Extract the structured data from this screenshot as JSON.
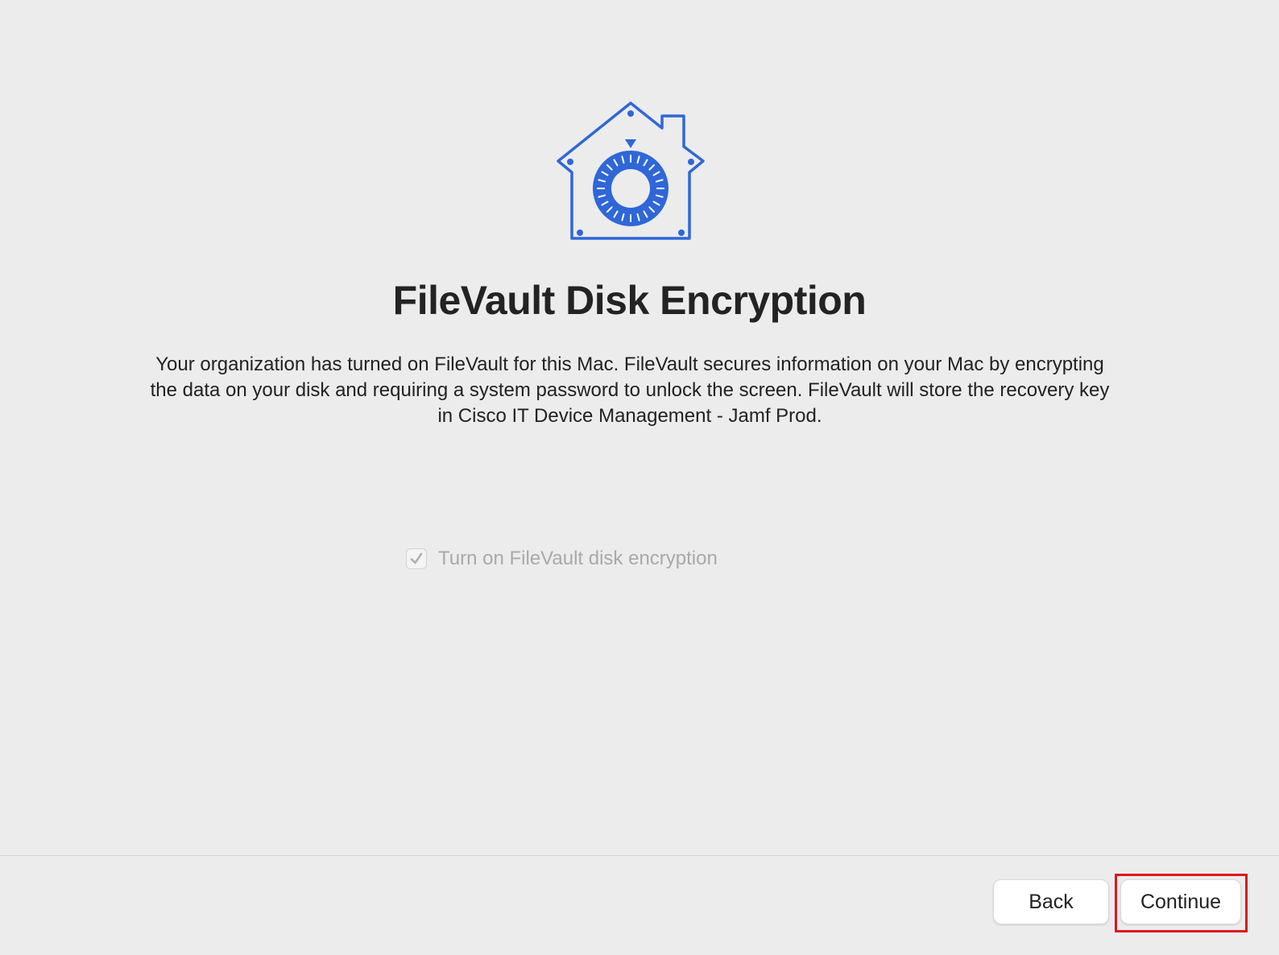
{
  "window": {
    "title": "FileVault Disk Encryption",
    "description": "Your organization has turned on FileVault for this Mac. FileVault secures information on your Mac by encrypting the data on your disk and requiring a system password to unlock the screen. FileVault will store the recovery key in Cisco IT Device Management - Jamf Prod."
  },
  "hero": {
    "icon": "filevault-house-safe-icon",
    "accent_color": "#2f67d8"
  },
  "option": {
    "label": "Turn on FileVault disk encryption",
    "checked": true,
    "disabled": true
  },
  "footer": {
    "back_label": "Back",
    "continue_label": "Continue",
    "highlight_color": "#e0141e"
  }
}
